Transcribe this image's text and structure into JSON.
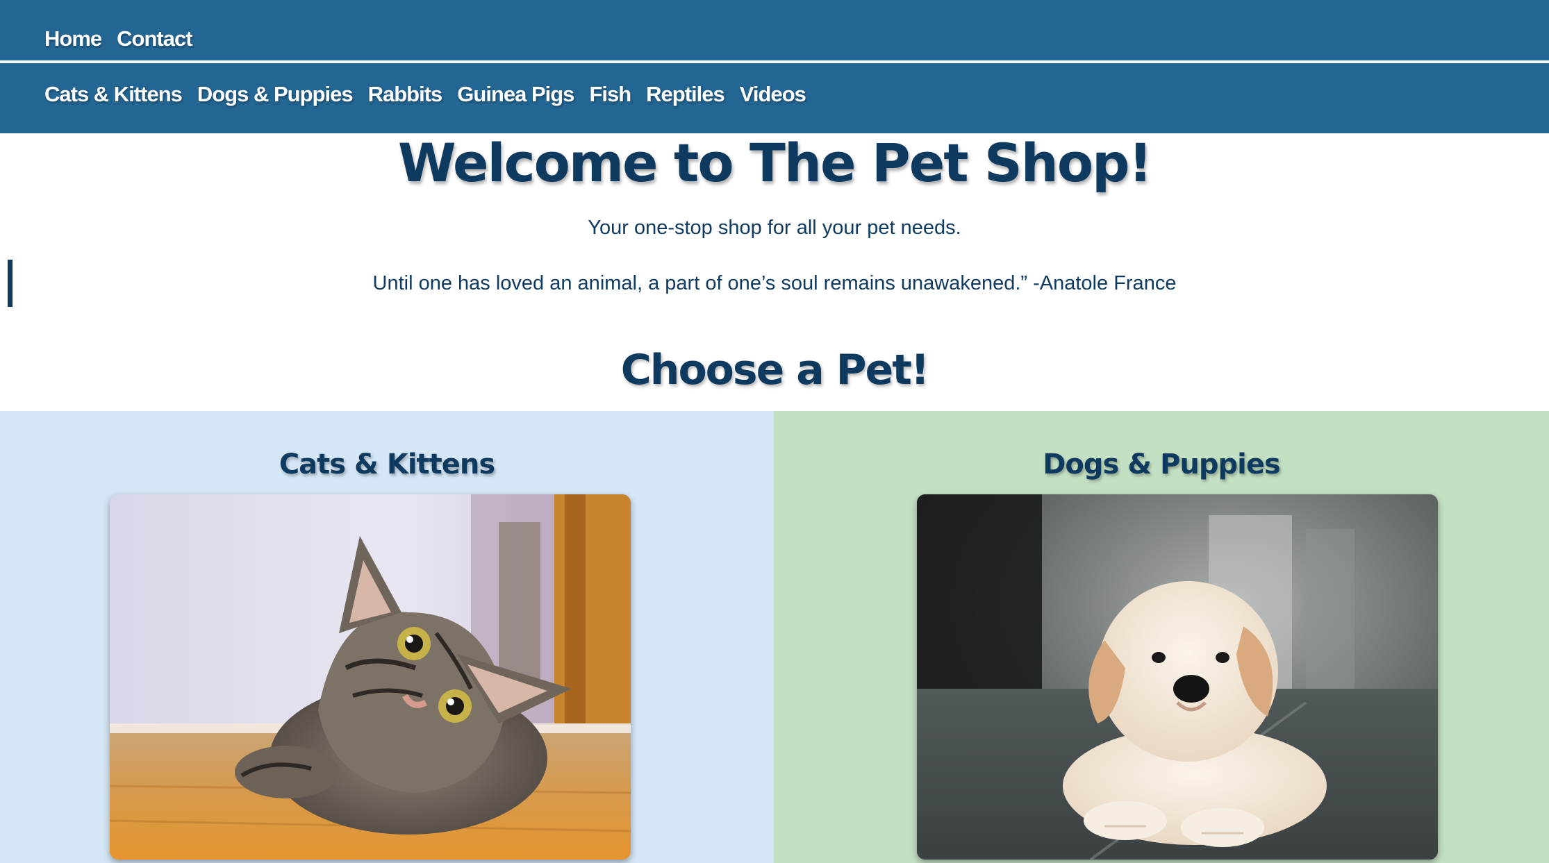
{
  "nav": {
    "primary": [
      {
        "label": "Home"
      },
      {
        "label": "Contact"
      }
    ],
    "secondary": [
      {
        "label": "Cats & Kittens"
      },
      {
        "label": "Dogs & Puppies"
      },
      {
        "label": "Rabbits"
      },
      {
        "label": "Guinea Pigs"
      },
      {
        "label": "Fish"
      },
      {
        "label": "Reptiles"
      },
      {
        "label": "Videos"
      }
    ]
  },
  "hero": {
    "title": "Welcome to The Pet Shop!",
    "tagline": "Your one-stop shop for all your pet needs.",
    "quote": "Until one has loved an animal, a part of one’s soul remains unawakened.” -Anatole France"
  },
  "choose": {
    "title": "Choose a Pet!",
    "pets": [
      {
        "heading": "Cats & Kittens",
        "image": "tabby-kitten-photo"
      },
      {
        "heading": "Dogs & Puppies",
        "image": "golden-puppy-photo"
      }
    ]
  },
  "colors": {
    "nav_bg": "#236694",
    "text_dark": "#0f3a5f",
    "cats_panel": "#d5e7f6",
    "dogs_panel": "#c4e0c3"
  }
}
